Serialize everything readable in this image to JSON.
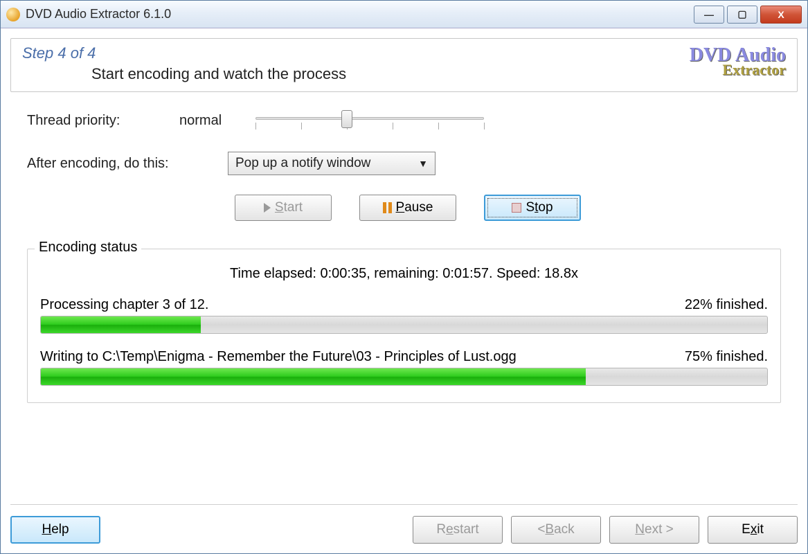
{
  "window": {
    "title": "DVD Audio Extractor 6.1.0"
  },
  "header": {
    "step": "Step 4 of 4",
    "description": "Start encoding and watch the process",
    "logo_top": "DVD Audio",
    "logo_bottom": "Extractor"
  },
  "priority": {
    "label": "Thread priority:",
    "value": "normal"
  },
  "after": {
    "label": "After encoding, do this:",
    "selected": "Pop up a notify window"
  },
  "buttons": {
    "start": "Start",
    "pause": "Pause",
    "stop": "Stop"
  },
  "status": {
    "legend": "Encoding status",
    "timing": "Time elapsed: 0:00:35, remaining: 0:01:57. Speed: 18.8x",
    "chapter_label": "Processing chapter 3 of 12.",
    "chapter_pct_label": "22% finished.",
    "chapter_pct": 22,
    "file_label": "Writing to C:\\Temp\\Enigma - Remember the Future\\03 - Principles of Lust.ogg",
    "file_pct_label": "75% finished.",
    "file_pct": 75
  },
  "footer": {
    "help": "Help",
    "restart": "Restart",
    "back": "< Back",
    "next": "Next >",
    "exit": "Exit"
  }
}
